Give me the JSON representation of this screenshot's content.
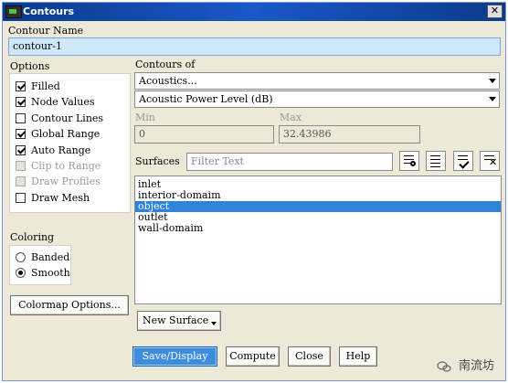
{
  "window": {
    "title": "Contours",
    "close_glyph": "✕"
  },
  "contour_name": {
    "label": "Contour Name",
    "value": "contour-1"
  },
  "options": {
    "label": "Options",
    "items": [
      {
        "label": "Filled",
        "checked": true,
        "enabled": true
      },
      {
        "label": "Node Values",
        "checked": true,
        "enabled": true
      },
      {
        "label": "Contour Lines",
        "checked": false,
        "enabled": true
      },
      {
        "label": "Global Range",
        "checked": true,
        "enabled": true
      },
      {
        "label": "Auto Range",
        "checked": true,
        "enabled": true
      },
      {
        "label": "Clip to Range",
        "checked": false,
        "enabled": false
      },
      {
        "label": "Draw Profiles",
        "checked": false,
        "enabled": false
      },
      {
        "label": "Draw Mesh",
        "checked": false,
        "enabled": true
      }
    ]
  },
  "coloring": {
    "label": "Coloring",
    "options": [
      {
        "label": "Banded",
        "selected": false
      },
      {
        "label": "Smooth",
        "selected": true
      }
    ]
  },
  "colormap_button": "Colormap Options...",
  "contours_of": {
    "label": "Contours of",
    "category": "Acoustics...",
    "quantity": "Acoustic Power Level (dB)",
    "min_label": "Min",
    "min_value": "0",
    "max_label": "Max",
    "max_value": "32.43986"
  },
  "surfaces": {
    "label": "Surfaces",
    "filter_placeholder": "Filter Text",
    "items": [
      "inlet",
      "interior-domaim",
      "object",
      "outlet",
      "wall-domaim"
    ],
    "selected_index": 2,
    "new_surface_button": "New Surface"
  },
  "buttons": {
    "save_display": "Save/Display",
    "compute": "Compute",
    "close": "Close",
    "help": "Help"
  },
  "watermark": {
    "text": "南流坊"
  }
}
